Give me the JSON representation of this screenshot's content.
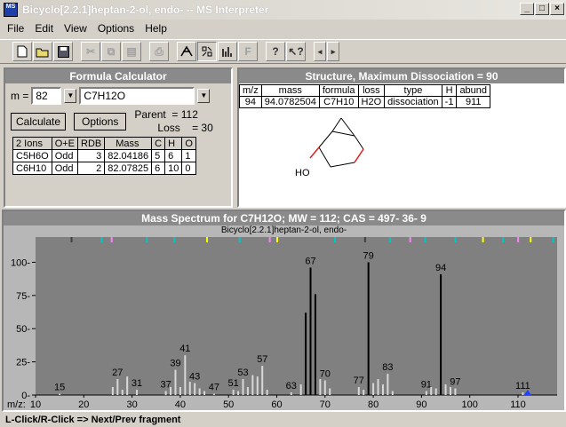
{
  "window": {
    "icon_text": "MS",
    "title": "Bicyclo[2.2.1]heptan-2-ol, endo- -- MS Interpreter"
  },
  "menu": [
    "File",
    "Edit",
    "View",
    "Options",
    "Help"
  ],
  "toolbar": {
    "periodic_label": "F",
    "help_label": "?"
  },
  "formula_calc": {
    "title": "Formula Calculator",
    "m_label": "m =",
    "m_value": "82",
    "formula_value": "C7H12O",
    "calculate": "Calculate",
    "options": "Options",
    "parent": "Parent  = 112",
    "loss": "Loss    = 30",
    "headers": [
      "2 Ions",
      "O+E",
      "RDB",
      "Mass",
      "C",
      "H",
      "O"
    ],
    "rows": [
      [
        "C5H6O",
        "Odd",
        "3",
        "82.04186",
        "5",
        "6",
        "1"
      ],
      [
        "C6H10",
        "Odd",
        "2",
        "82.07825",
        "6",
        "10",
        "0"
      ]
    ]
  },
  "structure": {
    "title": "Structure, Maximum Dissociation = 90",
    "headers": [
      "m/z",
      "mass",
      "formula",
      "loss",
      "type",
      "H",
      "abund"
    ],
    "row": [
      "94",
      "94.0782504",
      "C7H10",
      "H2O",
      "dissociation",
      "-1",
      "911"
    ],
    "ho_label": "HO"
  },
  "spectrum": {
    "title": "Mass Spectrum for C7H12O; MW = 112; CAS = 497- 36- 9",
    "subtitle": "Bicyclo[2.2.1]heptan-2-ol, endo-",
    "x_axis_title": "m/z:"
  },
  "status": "L-Click/R-Click => Next/Prev fragment",
  "chart_data": {
    "type": "bar",
    "title": "Mass Spectrum for C7H12O; MW = 112; CAS = 497- 36- 9",
    "xlabel": "m/z:",
    "ylabel": "",
    "xlim": [
      10,
      117
    ],
    "ylim": [
      0,
      115
    ],
    "xticks": [
      10,
      20,
      30,
      40,
      50,
      60,
      70,
      80,
      90,
      100,
      110
    ],
    "yticks": [
      0,
      25,
      50,
      75,
      100
    ],
    "peaks": [
      {
        "x": 15,
        "y": 1,
        "label": "15"
      },
      {
        "x": 26,
        "y": 6
      },
      {
        "x": 27,
        "y": 12,
        "label": "27"
      },
      {
        "x": 28,
        "y": 4
      },
      {
        "x": 29,
        "y": 14
      },
      {
        "x": 31,
        "y": 4,
        "label": "31"
      },
      {
        "x": 37,
        "y": 3,
        "label": "37"
      },
      {
        "x": 38,
        "y": 6
      },
      {
        "x": 39,
        "y": 19,
        "label": "39"
      },
      {
        "x": 40,
        "y": 6
      },
      {
        "x": 41,
        "y": 30,
        "label": "41"
      },
      {
        "x": 42,
        "y": 10
      },
      {
        "x": 43,
        "y": 9,
        "label": "43"
      },
      {
        "x": 44,
        "y": 5
      },
      {
        "x": 45,
        "y": 3
      },
      {
        "x": 47,
        "y": 1,
        "label": "47"
      },
      {
        "x": 51,
        "y": 4,
        "label": "51"
      },
      {
        "x": 52,
        "y": 3
      },
      {
        "x": 53,
        "y": 12,
        "label": "53"
      },
      {
        "x": 54,
        "y": 6
      },
      {
        "x": 55,
        "y": 15
      },
      {
        "x": 56,
        "y": 14
      },
      {
        "x": 57,
        "y": 22,
        "label": "57"
      },
      {
        "x": 58,
        "y": 4
      },
      {
        "x": 63,
        "y": 2,
        "label": "63"
      },
      {
        "x": 65,
        "y": 8
      },
      {
        "x": 66,
        "y": 62
      },
      {
        "x": 67,
        "y": 96,
        "label": "67"
      },
      {
        "x": 68,
        "y": 76
      },
      {
        "x": 69,
        "y": 12
      },
      {
        "x": 70,
        "y": 11,
        "label": "70"
      },
      {
        "x": 71,
        "y": 5
      },
      {
        "x": 77,
        "y": 6,
        "label": "77"
      },
      {
        "x": 78,
        "y": 4
      },
      {
        "x": 79,
        "y": 100,
        "label": "79"
      },
      {
        "x": 80,
        "y": 9
      },
      {
        "x": 81,
        "y": 12
      },
      {
        "x": 82,
        "y": 8
      },
      {
        "x": 83,
        "y": 16,
        "label": "83"
      },
      {
        "x": 84,
        "y": 3
      },
      {
        "x": 91,
        "y": 3,
        "label": "91"
      },
      {
        "x": 92,
        "y": 6
      },
      {
        "x": 93,
        "y": 5
      },
      {
        "x": 94,
        "y": 91,
        "label": "94"
      },
      {
        "x": 95,
        "y": 8
      },
      {
        "x": 96,
        "y": 6
      },
      {
        "x": 97,
        "y": 5,
        "label": "97"
      },
      {
        "x": 111,
        "y": 2,
        "label": "111"
      },
      {
        "x": 112,
        "y": 3
      }
    ],
    "highlight_x": 94
  }
}
